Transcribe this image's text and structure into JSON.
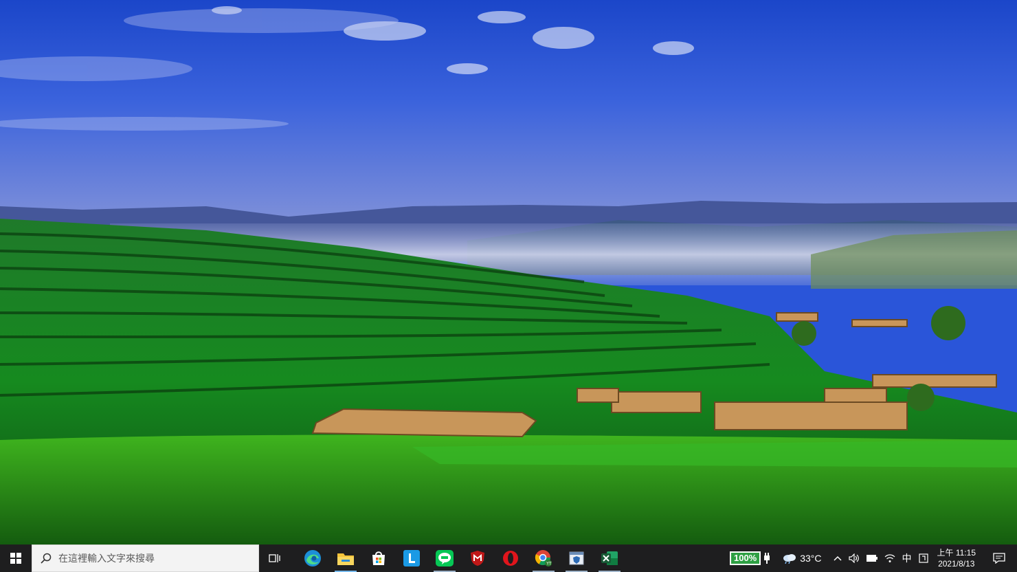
{
  "desktop": {
    "wallpaper": "terraced-green-fields-misty-valley"
  },
  "taskbar": {
    "start_icon": "windows-logo-icon",
    "search": {
      "placeholder": "在這裡輸入文字來搜尋",
      "icon": "search-icon"
    },
    "task_view_icon": "task-view-icon",
    "apps": [
      {
        "name": "edge-icon",
        "state": "normal"
      },
      {
        "name": "file-explorer-icon",
        "state": "active"
      },
      {
        "name": "microsoft-store-icon",
        "state": "normal"
      },
      {
        "name": "l-app-icon",
        "state": "normal"
      },
      {
        "name": "line-icon",
        "state": "open"
      },
      {
        "name": "mcafee-icon",
        "state": "normal"
      },
      {
        "name": "opera-icon",
        "state": "normal"
      },
      {
        "name": "chrome-youtube-icon",
        "state": "open"
      },
      {
        "name": "certificate-app-icon",
        "state": "open"
      },
      {
        "name": "excel-icon",
        "state": "open"
      }
    ],
    "tray": {
      "battery_percent": "100%",
      "temperature": "33°C",
      "ime": "中",
      "clock_time": "上午 11:15",
      "clock_date": "2021/8/13"
    },
    "colors": {
      "background": "#1e1e1f",
      "accent": "#76b9ed",
      "battery": "#2ea043"
    }
  }
}
